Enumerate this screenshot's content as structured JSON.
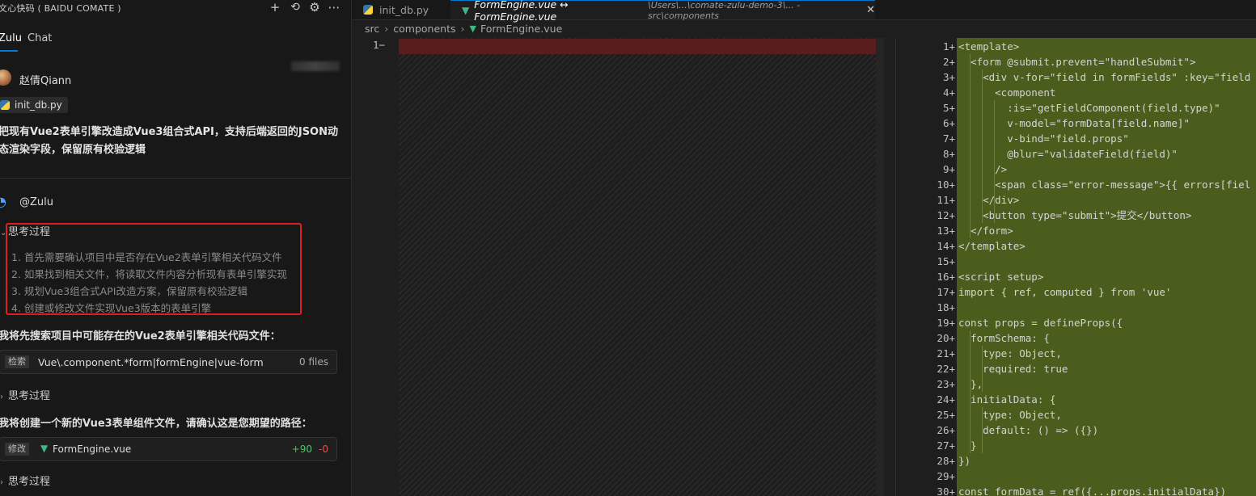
{
  "panel": {
    "title": "文心快码 ( BAIDU COMATE )",
    "header_icons": [
      "plus-icon",
      "history-icon",
      "settings-icon",
      "more-icon"
    ],
    "tabs": [
      "Zulu",
      "Chat"
    ],
    "user": {
      "name": "赵倩Qiann"
    },
    "attachment": {
      "name": "init_db.py",
      "icon": "python-icon"
    },
    "prompt": "把现有Vue2表单引擎改造成Vue3组合式API，支持后端返回的JSON动态渲染字段，保留原有校验逻辑",
    "assistant": {
      "name": "@Zulu"
    },
    "think_label": "思考过程",
    "think_steps": [
      "1. 首先需要确认项目中是否存在Vue2表单引擎相关代码文件",
      "2. 如果找到相关文件，将读取文件内容分析现有表单引擎实现",
      "3. 规划Vue3组合式API改造方案，保留原有校验逻辑",
      "4. 创建或修改文件实现Vue3版本的表单引擎"
    ],
    "msg_search": "我将先搜索项目中可能存在的Vue2表单引擎相关代码文件：",
    "search_tool": {
      "tag": "检索",
      "query": "Vue\\.component.*form|formEngine|vue-form",
      "count": "0 files"
    },
    "msg_create": "我将创建一个新的Vue3表单组件文件，请确认这是您期望的路径：",
    "edit_tool": {
      "tag": "修改",
      "file": "FormEngine.vue",
      "added": "+90",
      "removed": "-0"
    }
  },
  "editor": {
    "tab1": "init_db.py",
    "tab2_title": "FormEngine.vue ↔ FormEngine.vue",
    "tab2_desc": "\\Users\\...\\comate-zulu-demo-3\\... - src\\components",
    "breadcrumb": [
      "src",
      "components",
      "FormEngine.vue"
    ],
    "original_lines": [
      {
        "n": "1",
        "mark": "−"
      }
    ],
    "modified_lines": [
      {
        "n": "1",
        "code": "<template>"
      },
      {
        "n": "2",
        "code": "  <form @submit.prevent=\"handleSubmit\">"
      },
      {
        "n": "3",
        "code": "    <div v-for=\"field in formFields\" :key=\"field"
      },
      {
        "n": "4",
        "code": "      <component"
      },
      {
        "n": "5",
        "code": "        :is=\"getFieldComponent(field.type)\""
      },
      {
        "n": "6",
        "code": "        v-model=\"formData[field.name]\""
      },
      {
        "n": "7",
        "code": "        v-bind=\"field.props\""
      },
      {
        "n": "8",
        "code": "        @blur=\"validateField(field)\""
      },
      {
        "n": "9",
        "code": "      />"
      },
      {
        "n": "10",
        "code": "      <span class=\"error-message\">{{ errors[fiel"
      },
      {
        "n": "11",
        "code": "    </div>"
      },
      {
        "n": "12",
        "code": "    <button type=\"submit\">提交</button>"
      },
      {
        "n": "13",
        "code": "  </form>"
      },
      {
        "n": "14",
        "code": "</template>"
      },
      {
        "n": "15",
        "code": ""
      },
      {
        "n": "16",
        "code": "<script setup>"
      },
      {
        "n": "17",
        "code": "import { ref, computed } from 'vue'"
      },
      {
        "n": "18",
        "code": ""
      },
      {
        "n": "19",
        "code": "const props = defineProps({"
      },
      {
        "n": "20",
        "code": "  formSchema: {"
      },
      {
        "n": "21",
        "code": "    type: Object,"
      },
      {
        "n": "22",
        "code": "    required: true"
      },
      {
        "n": "23",
        "code": "  },"
      },
      {
        "n": "24",
        "code": "  initialData: {"
      },
      {
        "n": "25",
        "code": "    type: Object,"
      },
      {
        "n": "26",
        "code": "    default: () => ({})"
      },
      {
        "n": "27",
        "code": "  }"
      },
      {
        "n": "28",
        "code": "})"
      },
      {
        "n": "29",
        "code": ""
      },
      {
        "n": "30",
        "code": "const formData = ref({...props.initialData})"
      }
    ]
  }
}
